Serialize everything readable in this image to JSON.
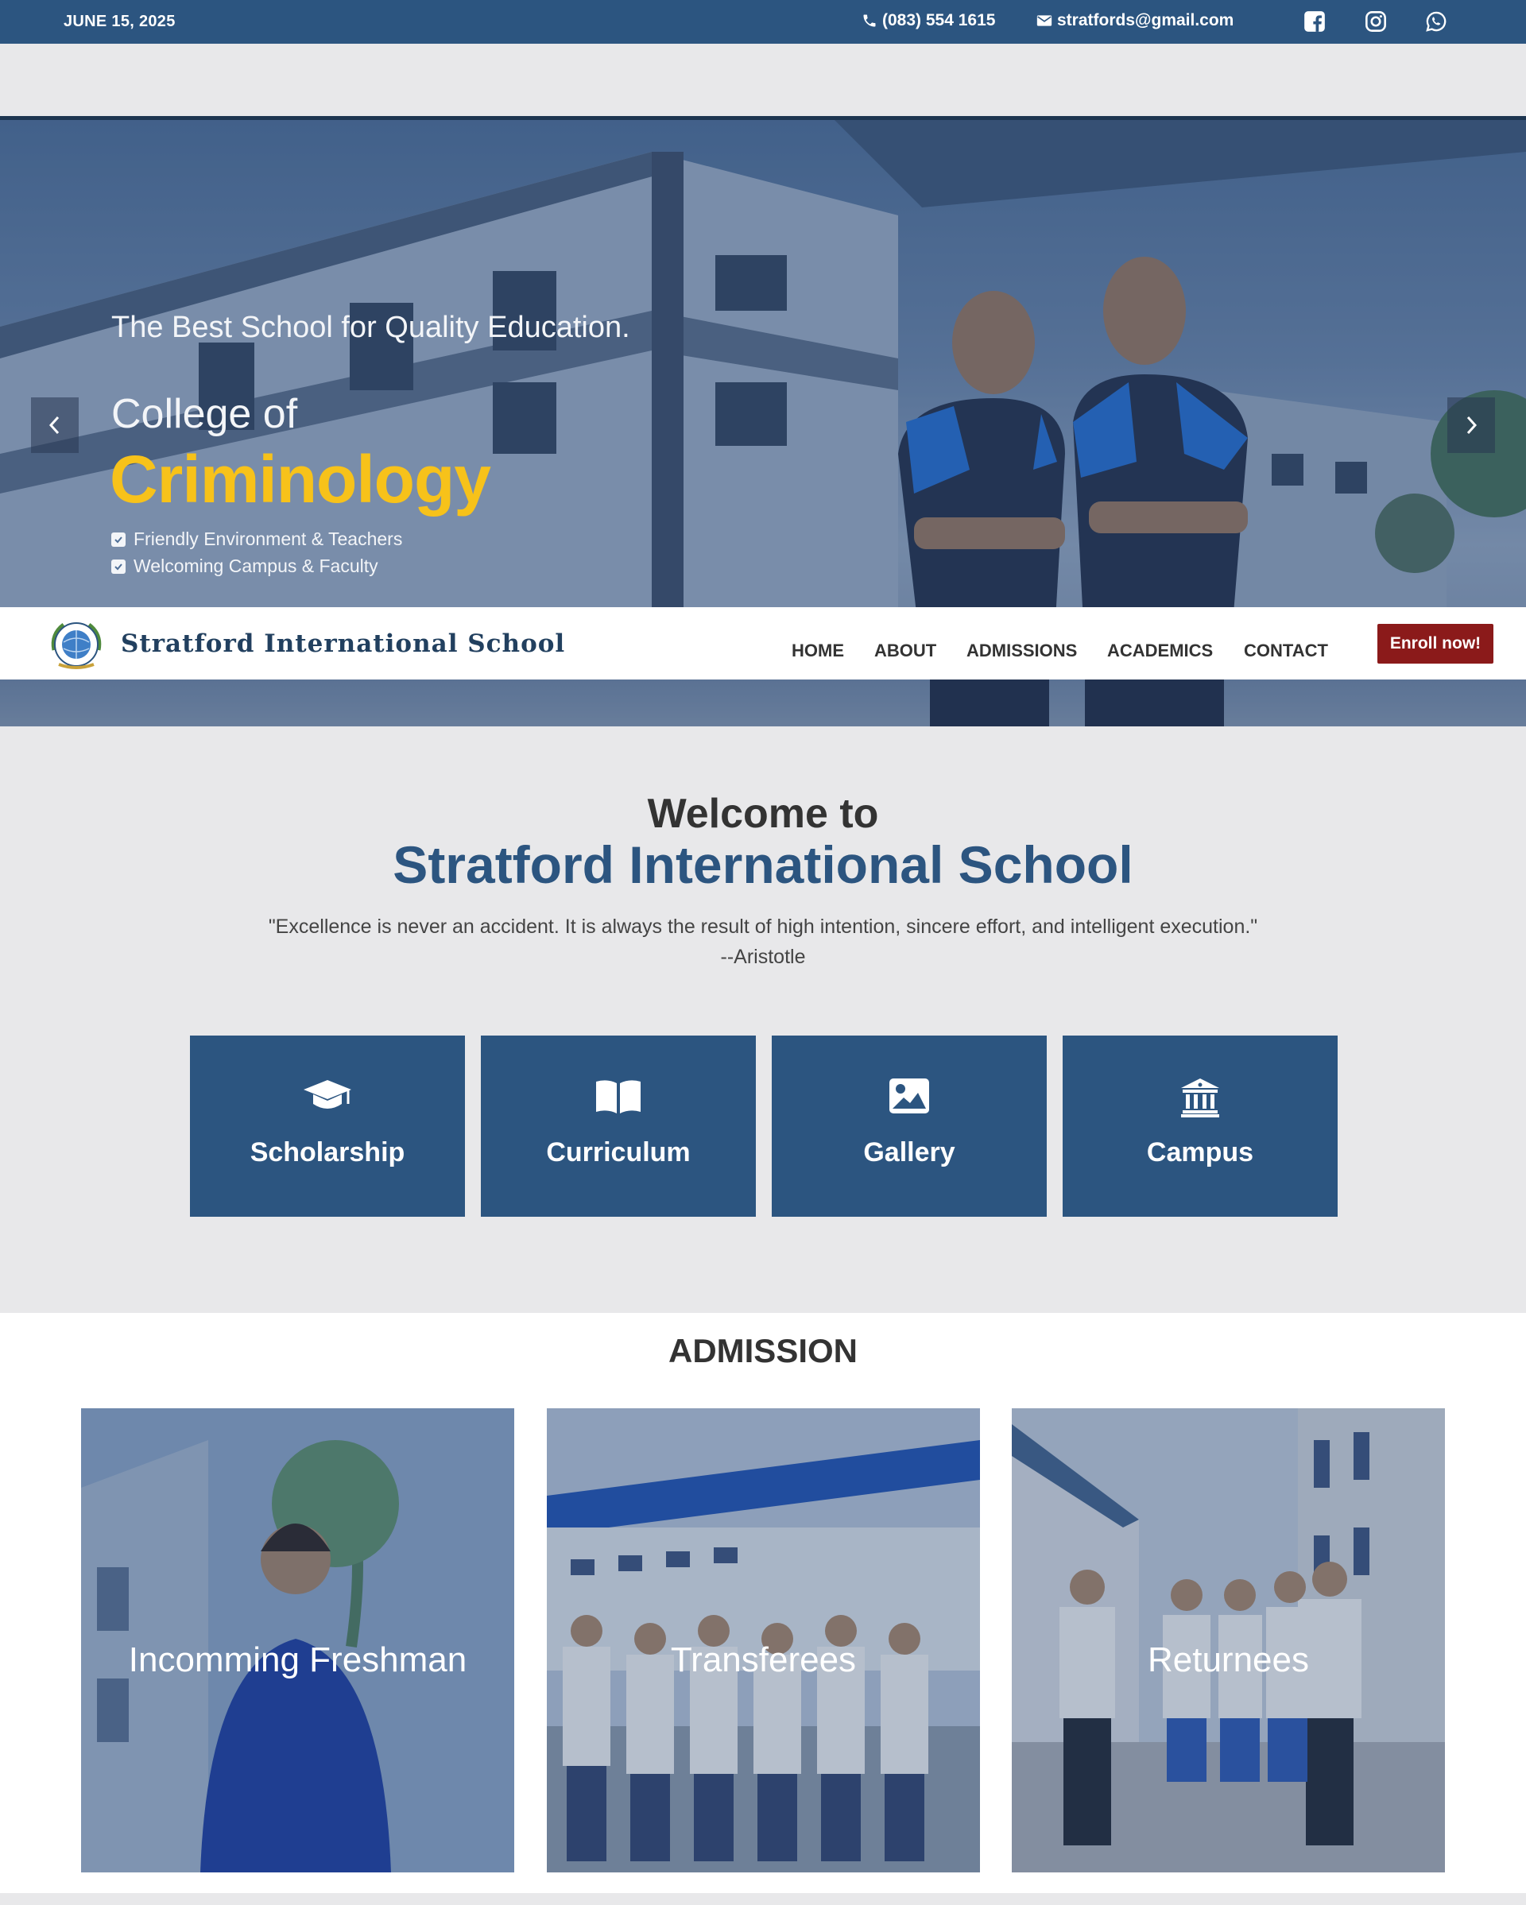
{
  "topbar": {
    "date": "JUNE 15, 2025",
    "phone": "(083) 554 1615",
    "email": "stratfords@gmail.com",
    "social_icons": [
      "facebook-icon",
      "instagram-icon",
      "whatsapp-icon"
    ]
  },
  "hero": {
    "tagline": "The Best School for Quality Education.",
    "college_label": "College of",
    "program": "Criminology",
    "features": [
      "Friendly Environment & Teachers",
      "Welcoming Campus & Faculty"
    ],
    "prev_icon": "chevron-left-icon",
    "next_icon": "chevron-right-icon"
  },
  "nav": {
    "brand": "Stratford International School",
    "menu": [
      "HOME",
      "ABOUT",
      "ADMISSIONS",
      "ACADEMICS",
      "CONTACT"
    ],
    "enroll_label": "Enroll now!"
  },
  "welcome": {
    "subtitle": "Welcome to",
    "title": "Stratford International School",
    "quote": "\"Excellence is never an accident. It is always the result of high intention, sincere effort, and intelligent execution.\"",
    "author": "--Aristotle"
  },
  "features": [
    {
      "label": "Scholarship",
      "icon": "graduation-cap-icon"
    },
    {
      "label": "Curriculum",
      "icon": "book-icon"
    },
    {
      "label": "Gallery",
      "icon": "image-icon"
    },
    {
      "label": "Campus",
      "icon": "university-icon"
    }
  ],
  "admission": {
    "heading": "ADMISSION",
    "cards": [
      "Incomming Freshman",
      "Transferees",
      "Returnees"
    ]
  },
  "colors": {
    "primary": "#2c5580",
    "accent_yellow": "#f7c21a",
    "enroll_red": "#8b1a1a"
  }
}
